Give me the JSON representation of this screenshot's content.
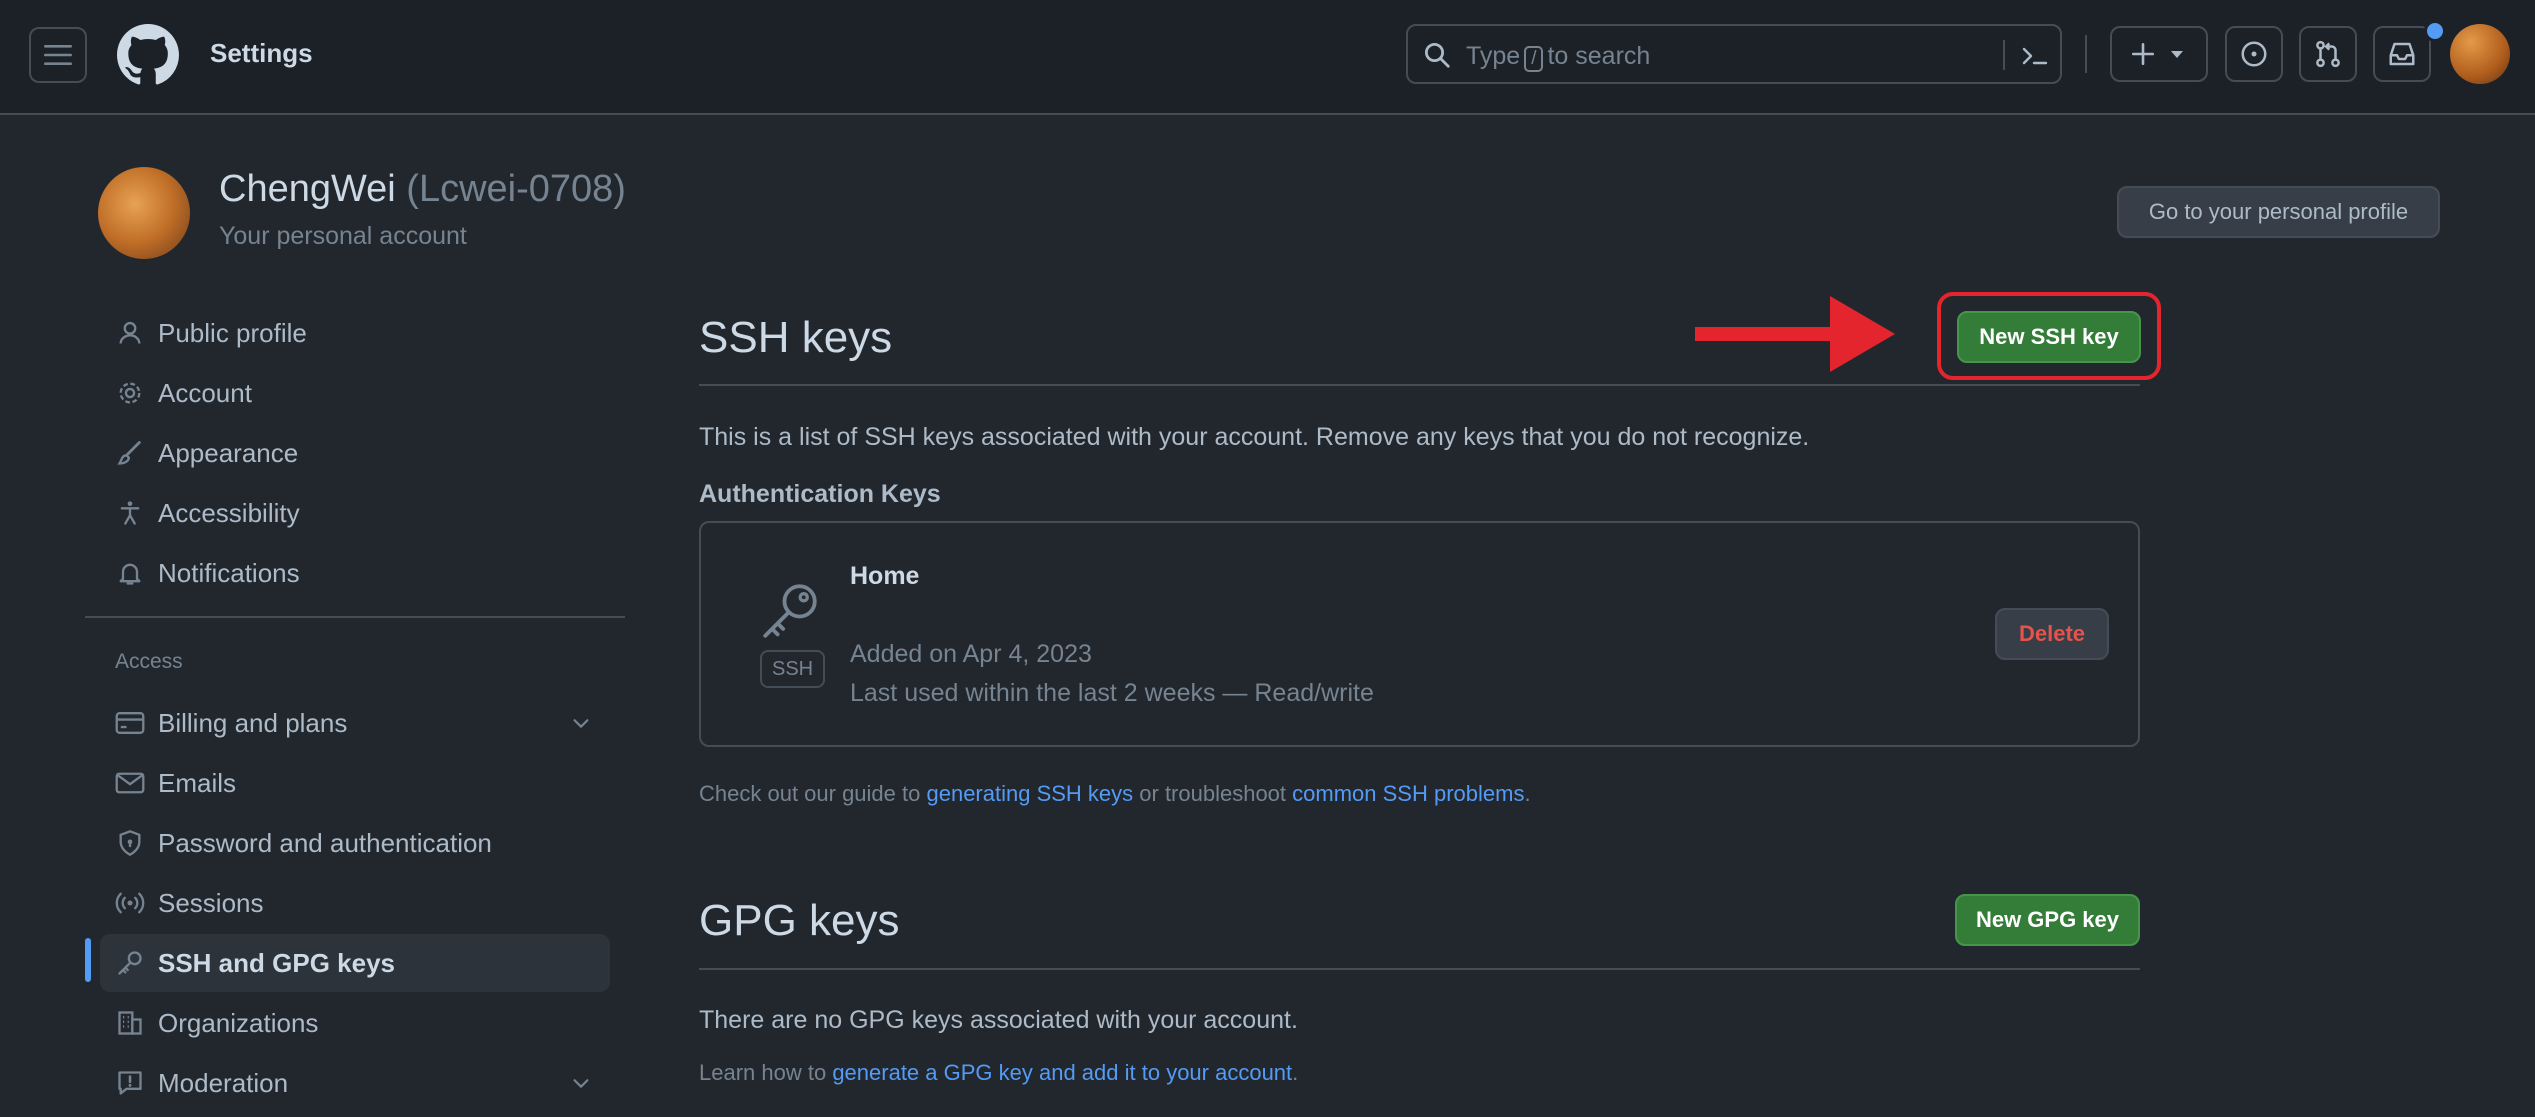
{
  "header": {
    "title": "Settings",
    "search": {
      "before": "Type",
      "key": "/",
      "after": "to search"
    },
    "plus_label": "+"
  },
  "profile": {
    "name": "ChengWei",
    "handle": "(Lcwei-0708)",
    "subtitle": "Your personal account",
    "go_button": "Go to your personal profile"
  },
  "sidebar": {
    "items": [
      {
        "label": "Public profile",
        "icon": "person-icon"
      },
      {
        "label": "Account",
        "icon": "gear-icon"
      },
      {
        "label": "Appearance",
        "icon": "paintbrush-icon"
      },
      {
        "label": "Accessibility",
        "icon": "accessibility-icon"
      },
      {
        "label": "Notifications",
        "icon": "bell-icon"
      }
    ],
    "access_heading": "Access",
    "access_items": [
      {
        "label": "Billing and plans",
        "icon": "credit-card-icon"
      },
      {
        "label": "Emails",
        "icon": "mail-icon"
      },
      {
        "label": "Password and authentication",
        "icon": "shield-lock-icon"
      },
      {
        "label": "Sessions",
        "icon": "broadcast-icon"
      },
      {
        "label": "SSH and GPG keys",
        "icon": "key-icon"
      },
      {
        "label": "Organizations",
        "icon": "organization-icon"
      },
      {
        "label": "Moderation",
        "icon": "report-icon"
      }
    ]
  },
  "ssh": {
    "title": "SSH keys",
    "new_button": "New SSH key",
    "description": "This is a list of SSH keys associated with your account. Remove any keys that you do not recognize.",
    "auth_heading": "Authentication Keys",
    "key": {
      "name": "Home",
      "type_badge": "SSH",
      "added": "Added on Apr 4, 2023",
      "last_used": "Last used within the last 2 weeks — Read/write",
      "delete_button": "Delete"
    },
    "guide": {
      "text1": "Check out our guide to ",
      "link1": "generating SSH keys",
      "text2": " or troubleshoot ",
      "link2": "common SSH problems",
      "text3": "."
    }
  },
  "gpg": {
    "title": "GPG keys",
    "new_button": "New GPG key",
    "empty": "There are no GPG keys associated with your account.",
    "learn": {
      "text1": "Learn how to ",
      "link": "generate a GPG key and add it to your account",
      "text2": "."
    }
  },
  "colors": {
    "accent_blue": "#539bf5",
    "button_green": "#347d39",
    "annotation_red": "#e5252e",
    "danger_red": "#e5534b"
  }
}
